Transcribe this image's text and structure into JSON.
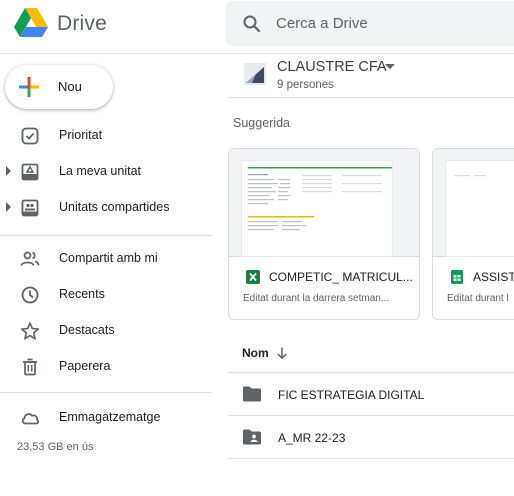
{
  "app": {
    "name": "Drive"
  },
  "search": {
    "placeholder": "Cerca a Drive",
    "icon": "search-icon"
  },
  "new_button": {
    "label": "Nou"
  },
  "sidebar": {
    "items": [
      {
        "label": "Prioritat",
        "icon": "check-circle-icon"
      },
      {
        "label": "La meva unitat",
        "icon": "my-drive-icon",
        "expandable": true
      },
      {
        "label": "Unitats compartides",
        "icon": "shared-drives-icon",
        "expandable": true
      },
      {
        "label": "Compartit amb mi",
        "icon": "people-icon"
      },
      {
        "label": "Recents",
        "icon": "clock-icon"
      },
      {
        "label": "Destacats",
        "icon": "star-icon"
      },
      {
        "label": "Paperera",
        "icon": "trash-icon"
      },
      {
        "label": "Emmagatzematge",
        "icon": "cloud-icon"
      }
    ],
    "storage_used": "23,53 GB en ús"
  },
  "folder": {
    "title": "CLAUSTRE CFA",
    "subtitle": "9 persones"
  },
  "suggested": {
    "title": "Suggerida",
    "cards": [
      {
        "name": "COMPETIC_ MATRICUL...",
        "meta": "Editat durant la darrera setman...",
        "icon": "excel-icon"
      },
      {
        "name": "ASSISTE",
        "meta": "Editat durant l",
        "icon": "sheets-icon"
      }
    ]
  },
  "list": {
    "column_name": "Nom",
    "rows": [
      {
        "name": "FIC ESTRATEGIA DIGITAL",
        "icon": "folder-icon"
      },
      {
        "name": "A_MR 22-23",
        "icon": "shared-folder-icon"
      }
    ]
  },
  "colors": {
    "accent_blue": "#1a73e8",
    "excel_green": "#1e7e45",
    "sheets_green": "#0f9d58",
    "icon_gray": "#5f6368"
  }
}
